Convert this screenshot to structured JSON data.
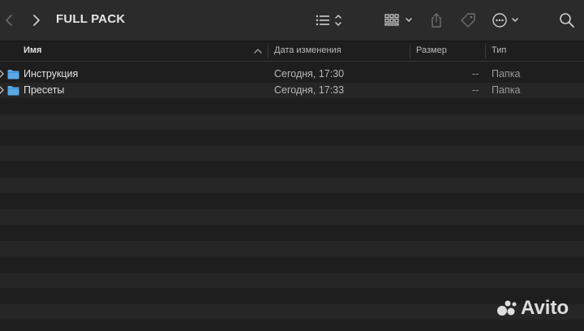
{
  "window": {
    "title": "FULL PACK"
  },
  "toolbar": {
    "back_icon": "chevron-left-icon",
    "forward_icon": "chevron-right-icon",
    "view_list_icon": "list-icon",
    "group_icon": "grid-icon",
    "share_icon": "share-icon",
    "tag_icon": "tag-icon",
    "more_icon": "ellipsis-circle-icon"
  },
  "columns": {
    "name": "Имя",
    "date": "Дата изменения",
    "size": "Размер",
    "kind": "Тип"
  },
  "files": [
    {
      "name": "Инструкция",
      "date": "Сегодня, 17:30",
      "size": "--",
      "kind": "Папка"
    },
    {
      "name": "Пресеты",
      "date": "Сегодня, 17:33",
      "size": "--",
      "kind": "Папка"
    }
  ],
  "watermark": {
    "text": "Avito"
  },
  "colors": {
    "folder": "#5aa9e6",
    "background": "#1e1e1e",
    "stripe": "#262626"
  }
}
